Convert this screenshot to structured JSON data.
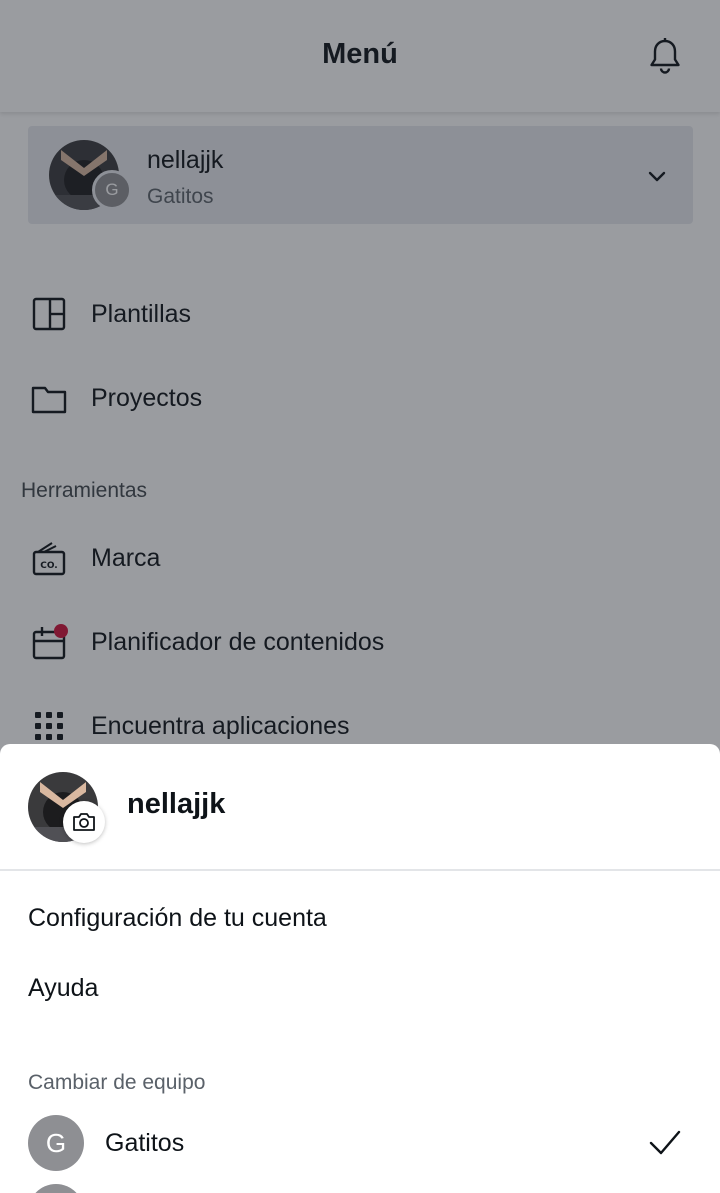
{
  "header": {
    "title": "Menú",
    "bell_icon": "bell-icon"
  },
  "account": {
    "name": "nellajjk",
    "team": "Gatitos",
    "team_initial": "G"
  },
  "nav": {
    "items": [
      {
        "label": "Plantillas",
        "icon": "template-icon"
      },
      {
        "label": "Proyectos",
        "icon": "folder-icon"
      }
    ],
    "tools_section": "Herramientas",
    "tools": [
      {
        "label": "Marca",
        "icon": "brand-kit-icon"
      },
      {
        "label": "Planificador de contenidos",
        "icon": "calendar-icon"
      },
      {
        "label": "Encuentra aplicaciones",
        "icon": "apps-grid-icon"
      }
    ]
  },
  "sheet": {
    "name": "nellajjk",
    "items": [
      {
        "label": "Configuración de tu cuenta"
      },
      {
        "label": "Ayuda"
      }
    ],
    "switch_team_label": "Cambiar de equipo",
    "teams": [
      {
        "initial": "G",
        "name": "Gatitos",
        "selected": true
      }
    ]
  },
  "colors": {
    "overlay": "#1e232d",
    "notification_dot": "#d0103a",
    "team_avatar": "#8e8f93"
  }
}
